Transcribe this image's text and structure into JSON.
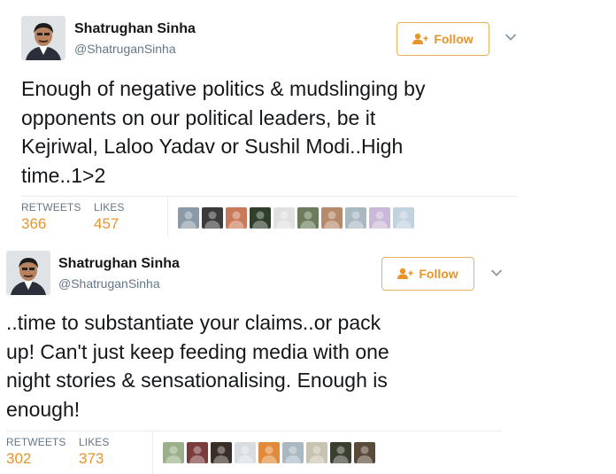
{
  "tweets": [
    {
      "author": {
        "name": "Shatrughan Sinha",
        "handle": "@ShatruganSinha"
      },
      "follow_label": "Follow",
      "text_lines": [
        "Enough of negative politics & mudslinging by",
        "opponents on our political leaders, be it",
        "Kejriwal, Laloo Yadav or Sushil Modi..High",
        "time..1>2"
      ],
      "stats": {
        "retweets_label": "RETWEETS",
        "retweets": "366",
        "likes_label": "LIKES",
        "likes": "457"
      },
      "likers": [
        "#8a9aa8",
        "#3b3b3b",
        "#c97a5a",
        "#2f3f2a",
        "#e0e0e0",
        "#6b7b5b",
        "#b58a6a",
        "#aab8c2",
        "#c9b8d8",
        "#c2d2de"
      ]
    },
    {
      "author": {
        "name": "Shatrughan Sinha",
        "handle": "@ShatruganSinha"
      },
      "follow_label": "Follow",
      "text_lines": [
        "..time to substantiate your claims..or pack",
        "up! Can't just keep feeding media with one",
        "night stories & sensationalising. Enough is",
        "enough!"
      ],
      "stats": {
        "retweets_label": "RETWEETS",
        "retweets": "302",
        "likes_label": "LIKES",
        "likes": "373"
      },
      "likers": [
        "#9bb08a",
        "#7a3b3b",
        "#3a2e28",
        "#d9dde0",
        "#e08a3a",
        "#aab8c2",
        "#c8c2b0",
        "#3a4030",
        "#5a4a3a"
      ]
    }
  ],
  "colors": {
    "accent": "#e8942a",
    "follow_border": "#e8b15c",
    "muted": "#657786"
  },
  "icons": {
    "follow": "person-add-icon",
    "more": "chevron-down-icon"
  }
}
